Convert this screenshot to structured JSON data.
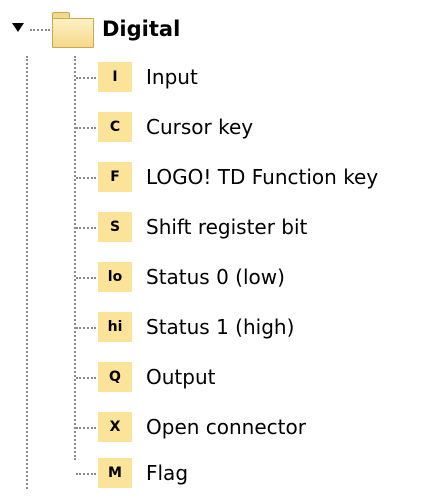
{
  "tree": {
    "root": {
      "label": "Digital",
      "expanded": true,
      "icon": "folder-icon"
    },
    "items": [
      {
        "badge": "I",
        "label": "Input"
      },
      {
        "badge": "C",
        "label": "Cursor key"
      },
      {
        "badge": "F",
        "label": "LOGO! TD Function key"
      },
      {
        "badge": "S",
        "label": "Shift register bit"
      },
      {
        "badge": "lo",
        "label": "Status 0 (low)"
      },
      {
        "badge": "hi",
        "label": "Status 1 (high)"
      },
      {
        "badge": "Q",
        "label": "Output"
      },
      {
        "badge": "X",
        "label": "Open connector"
      },
      {
        "badge": "M",
        "label": "Flag"
      }
    ]
  },
  "colors": {
    "badge_background": "#fbe39a",
    "folder": "#f5d88a",
    "guide_line": "#8a8a8a"
  }
}
